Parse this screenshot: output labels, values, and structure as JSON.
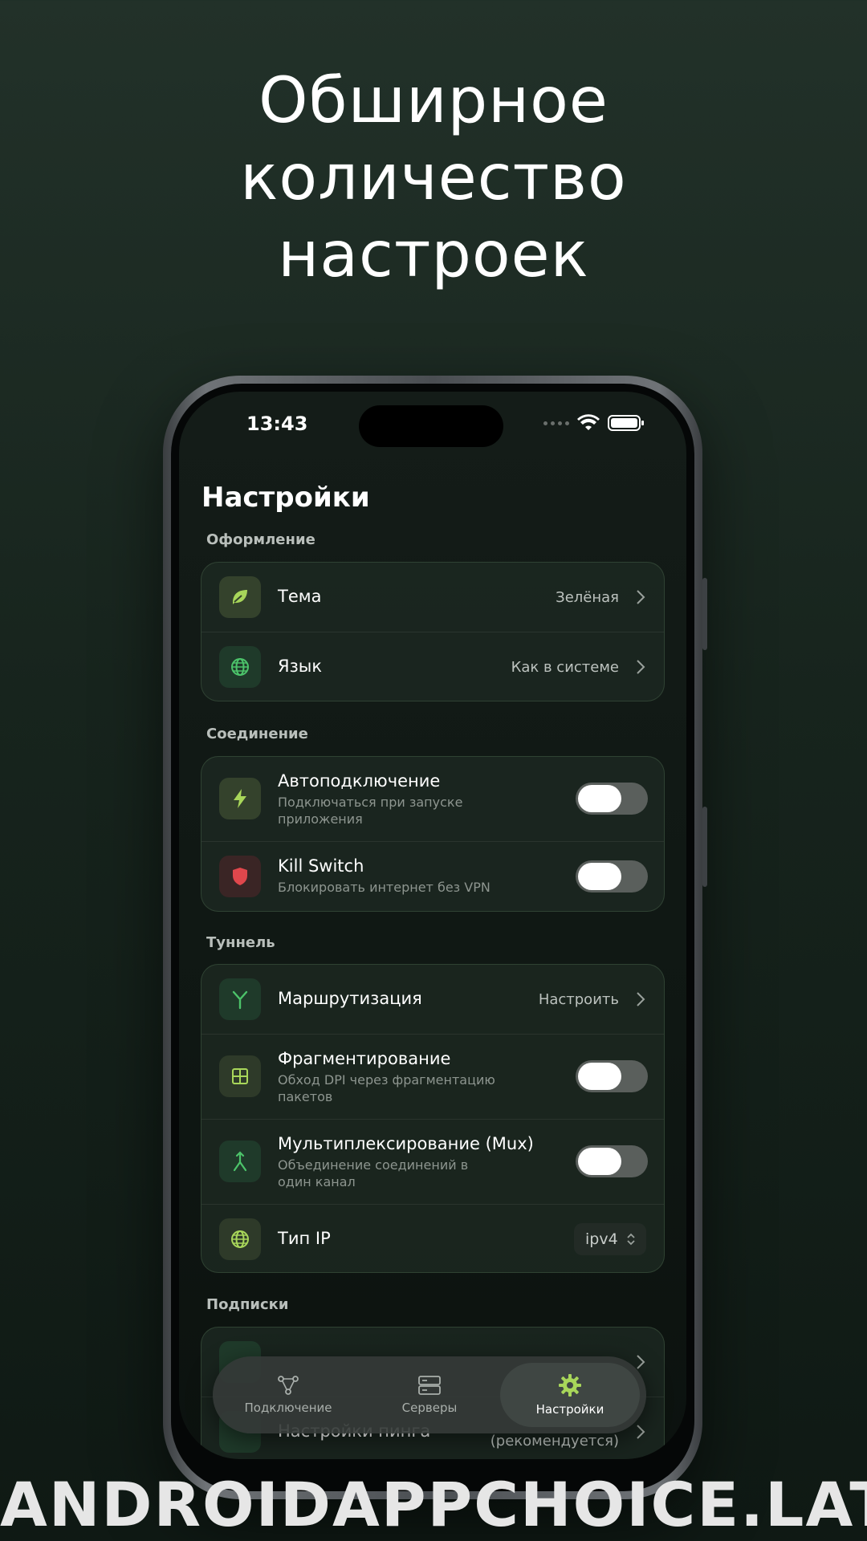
{
  "promo": {
    "title": "Обширное\nколичество\nнастроек"
  },
  "status_bar": {
    "time": "13:43"
  },
  "page": {
    "title": "Настройки"
  },
  "sections": {
    "appearance": {
      "label": "Оформление",
      "theme": {
        "title": "Тема",
        "value": "Зелёная",
        "icon": "leaf-icon"
      },
      "language": {
        "title": "Язык",
        "value": "Как в системе",
        "icon": "globe-icon"
      }
    },
    "connection": {
      "label": "Соединение",
      "autoconnect": {
        "title": "Автоподключение",
        "subtitle": "Подключаться при запуске приложения",
        "icon": "bolt-icon",
        "enabled": false
      },
      "killswitch": {
        "title": "Kill Switch",
        "subtitle": "Блокировать интернет без VPN",
        "icon": "shield-icon",
        "enabled": false
      }
    },
    "tunnel": {
      "label": "Туннель",
      "routing": {
        "title": "Маршрутизация",
        "value": "Настроить",
        "icon": "route-icon"
      },
      "fragmentation": {
        "title": "Фрагментирование",
        "subtitle": "Обход DPI через фрагментацию пакетов",
        "icon": "grid-icon",
        "enabled": false
      },
      "mux": {
        "title": "Мультиплексирование (Mux)",
        "subtitle": "Объединение соединений в один канал",
        "icon": "merge-icon",
        "enabled": false
      },
      "ip_type": {
        "title": "Тип IP",
        "value": "ipv4",
        "icon": "globe-icon"
      }
    },
    "subscriptions": {
      "label": "Подписки",
      "ping": {
        "title": "Настройки пинга",
        "value": "(рекомендуется)"
      }
    }
  },
  "tabbar": {
    "tabs": [
      {
        "label": "Подключение",
        "icon": "connection-icon",
        "active": false
      },
      {
        "label": "Серверы",
        "icon": "servers-icon",
        "active": false
      },
      {
        "label": "Настройки",
        "icon": "gear-icon",
        "active": true
      }
    ]
  },
  "watermark": {
    "text": "ANDROIDAPPCHOICE.LAT"
  },
  "colors": {
    "accent": "#8dc63f",
    "accent_green": "#4caf50",
    "danger": "#e0474c",
    "background": "#1a2620"
  }
}
